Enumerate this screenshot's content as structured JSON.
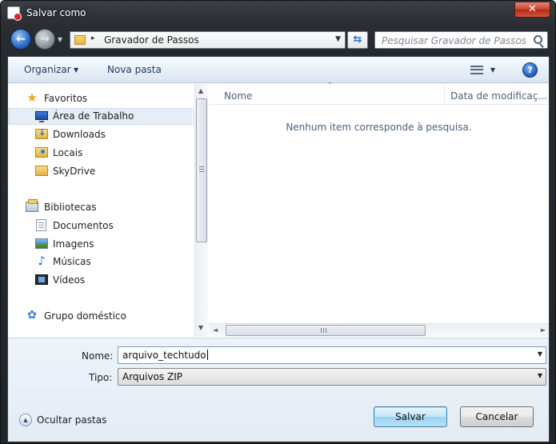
{
  "window": {
    "title": "Salvar como",
    "close_glyph": "✕"
  },
  "nav": {
    "back_glyph": "←",
    "forward_glyph": "→",
    "history_glyph": "▼",
    "address": {
      "separator": "▸",
      "folder": "Gravador de Passos",
      "dropdown_glyph": "▼"
    },
    "refresh_glyph": "⇆",
    "search": {
      "placeholder": "Pesquisar Gravador de Passos"
    }
  },
  "toolbar": {
    "organize_label": "Organizar",
    "organize_arrow": "▼",
    "new_folder_label": "Nova pasta",
    "views_arrow": "▼",
    "help_glyph": "?"
  },
  "sidebar": {
    "favorites": {
      "label": "Favoritos",
      "icon": "★",
      "items": [
        {
          "label": "Área de Trabalho",
          "icon": "desktop-icon",
          "selected": true
        },
        {
          "label": "Downloads",
          "icon": "downloads-folder-icon"
        },
        {
          "label": "Locais",
          "icon": "places-icon"
        },
        {
          "label": "SkyDrive",
          "icon": "folder-icon"
        }
      ]
    },
    "libraries": {
      "label": "Bibliotecas",
      "items": [
        {
          "label": "Documentos",
          "icon": "documents-icon"
        },
        {
          "label": "Imagens",
          "icon": "pictures-icon"
        },
        {
          "label": "Músicas",
          "icon": "music-icon",
          "glyph": "♪"
        },
        {
          "label": "Vídeos",
          "icon": "videos-icon"
        }
      ]
    },
    "homegroup": {
      "label": "Grupo doméstico",
      "icon": "homegroup-icon",
      "glyph": "✿"
    },
    "scroll_up_glyph": "▲",
    "scroll_down_glyph": "▼"
  },
  "content": {
    "sort_glyph": "˄",
    "columns": [
      "Nome",
      "Data de modificaç..."
    ],
    "empty_message": "Nenhum item corresponde à pesquisa.",
    "scroll_left_glyph": "◄",
    "scroll_right_glyph": "►"
  },
  "form": {
    "name_label": "Nome:",
    "name_value": "arquivo_techtudo",
    "name_dropdown_glyph": "▼",
    "type_label": "Tipo:",
    "type_value": "Arquivos ZIP",
    "type_dropdown_glyph": "▼"
  },
  "footer": {
    "hide_folders_label": "Ocultar pastas",
    "hide_folders_glyph": "▲",
    "save_label": "Salvar",
    "cancel_label": "Cancelar"
  },
  "colors": {
    "accent": "#3c7fb1",
    "selection": "#e5edf6",
    "frame": "#2a2e33"
  }
}
